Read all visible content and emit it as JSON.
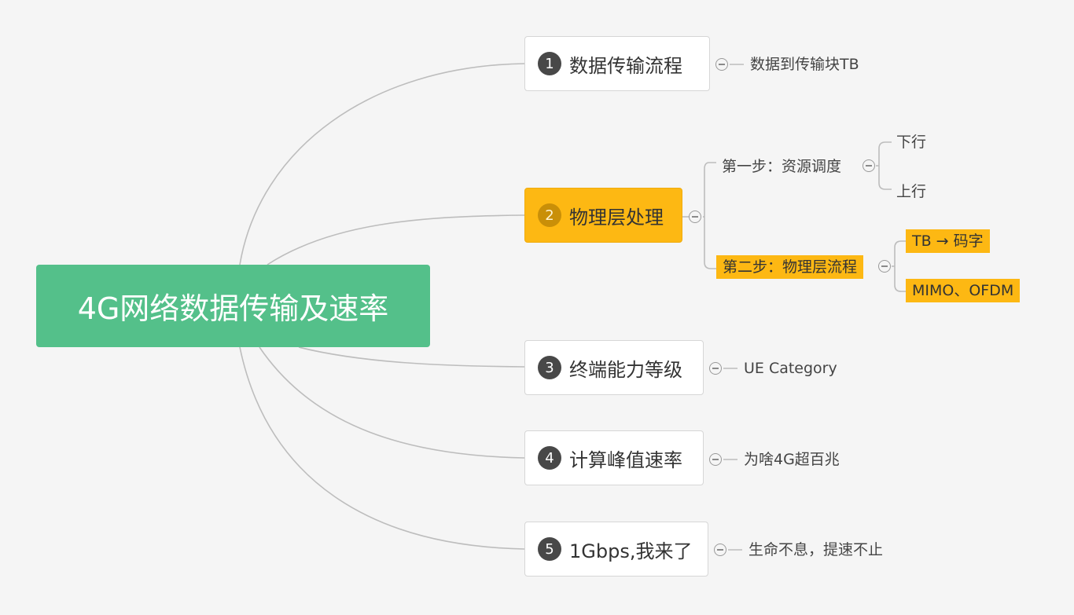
{
  "root": {
    "label": "4G网络数据传输及速率",
    "color": "#54c08a"
  },
  "branches": [
    {
      "num": "1",
      "label": "数据传输流程",
      "child": "数据到传输块TB"
    },
    {
      "num": "2",
      "label": "物理层处理",
      "highlight": "#fdb813",
      "steps": [
        {
          "label": "第一步：资源调度",
          "children": [
            "下行",
            "上行"
          ]
        },
        {
          "label": "第二步：物理层流程",
          "children": [
            "TB → 码字",
            "MIMO、OFDM"
          ]
        }
      ]
    },
    {
      "num": "3",
      "label": "终端能力等级",
      "child": "UE Category"
    },
    {
      "num": "4",
      "label": "计算峰值速率",
      "child": "为啥4G超百兆"
    },
    {
      "num": "5",
      "label": "1Gbps,我来了",
      "child": "生命不息，提速不止"
    }
  ]
}
